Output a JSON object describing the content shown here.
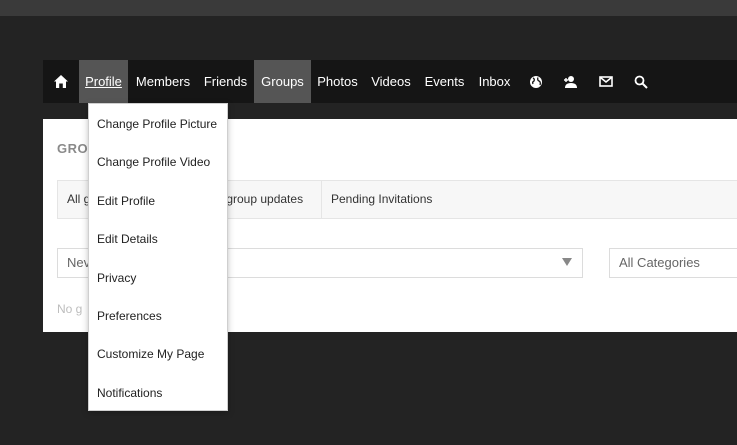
{
  "nav": {
    "home_icon": "home-icon",
    "items": [
      {
        "label": "Profile"
      },
      {
        "label": "Members"
      },
      {
        "label": "Friends"
      },
      {
        "label": "Groups"
      },
      {
        "label": "Photos"
      },
      {
        "label": "Videos"
      },
      {
        "label": "Events"
      },
      {
        "label": "Inbox"
      }
    ],
    "icons": [
      "globe-icon",
      "add-friend-icon",
      "mail-icon",
      "search-icon"
    ]
  },
  "profile_menu": {
    "items": [
      {
        "label": "Change Profile Picture"
      },
      {
        "label": "Change Profile Video"
      },
      {
        "label": "Edit Profile"
      },
      {
        "label": "Edit Details"
      },
      {
        "label": "Privacy"
      },
      {
        "label": "Preferences"
      },
      {
        "label": "Customize My Page"
      },
      {
        "label": "Notifications"
      }
    ]
  },
  "page": {
    "title": "GRO",
    "tabs": [
      {
        "label": "All g"
      },
      {
        "label": "y group updates"
      },
      {
        "label": "Pending Invitations"
      }
    ],
    "sort_select": {
      "value": "Nev"
    },
    "category_select": {
      "value": "All Categories"
    },
    "empty_message": "No g"
  }
}
